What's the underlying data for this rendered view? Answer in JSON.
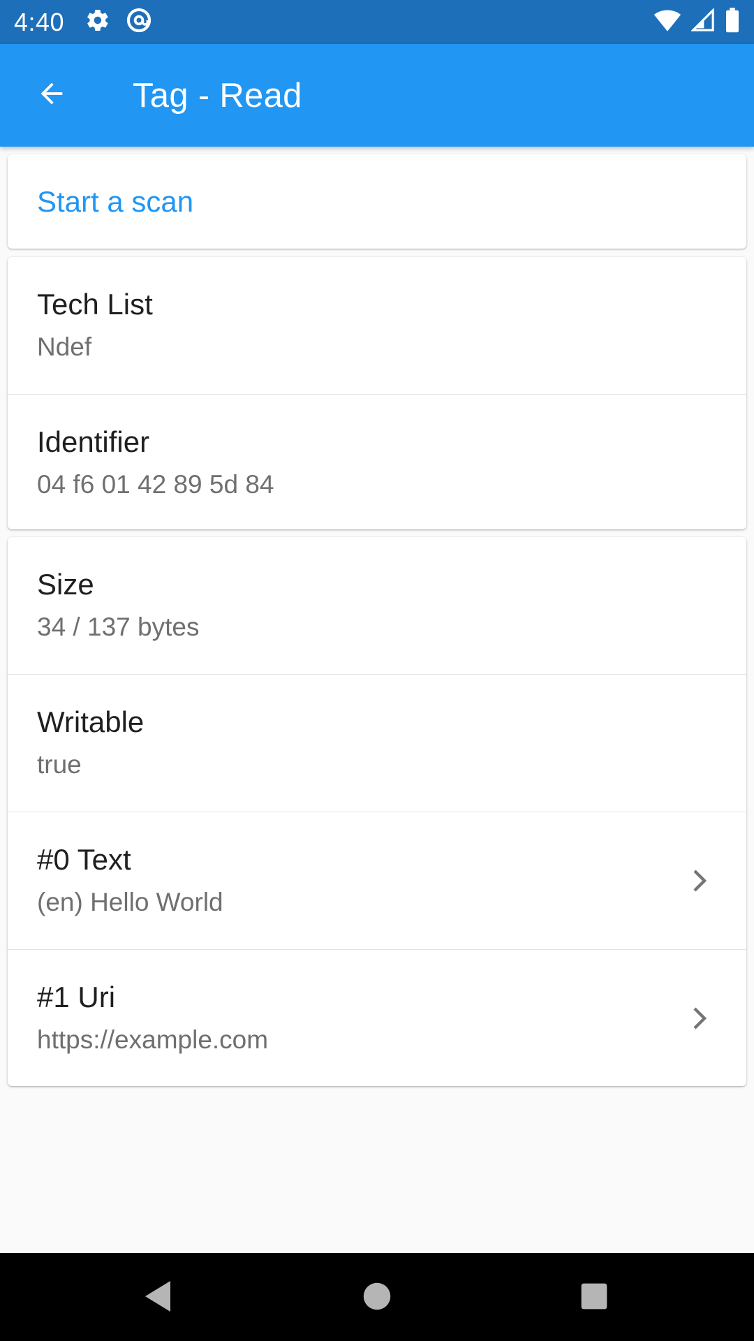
{
  "status_bar": {
    "time": "4:40",
    "icons_left": [
      "gear-icon",
      "at-sign-icon"
    ],
    "icons_right": [
      "wifi-icon",
      "cell-signal-icon",
      "battery-icon"
    ]
  },
  "app_bar": {
    "title": "Tag - Read",
    "back_icon": "arrow-left-icon"
  },
  "scan": {
    "label": "Start a scan"
  },
  "info_rows": [
    {
      "title": "Tech List",
      "value": "Ndef"
    },
    {
      "title": "Identifier",
      "value": "04 f6 01 42 89 5d 84"
    }
  ],
  "ndef_rows": [
    {
      "title": "Size",
      "value": "34 / 137 bytes"
    },
    {
      "title": "Writable",
      "value": "true"
    },
    {
      "title": "#0 Text",
      "value": "(en) Hello World",
      "chevron": true
    },
    {
      "title": "#1 Uri",
      "value": "https://example.com",
      "chevron": true
    }
  ],
  "colors": {
    "primary": "#2196F3",
    "status_bar": "#1E6FBA",
    "background": "#FAFAFA"
  },
  "nav_bar": {
    "buttons": [
      "back-triangle-icon",
      "home-circle-icon",
      "recents-square-icon"
    ]
  }
}
